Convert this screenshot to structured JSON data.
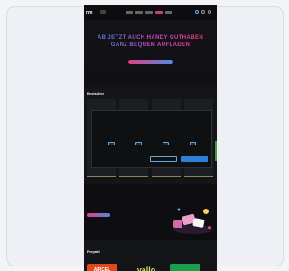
{
  "topbar": {
    "logo": "nm",
    "nav_links": [
      "",
      "",
      "",
      "",
      ""
    ]
  },
  "hero": {
    "title": "AB JETZT AUCH HANDY GUTHABEN GANZ BEQUEM AUFLADEN",
    "subtitle": "",
    "cta": ""
  },
  "section1": {
    "title": "Bestseller",
    "link": "",
    "cookie": {
      "heading": "",
      "logo": "",
      "text": "",
      "toggles": [
        "",
        "",
        "",
        ""
      ],
      "button_settings": "",
      "button_accept": ""
    }
  },
  "section2": {
    "title": "",
    "subtitle": "",
    "button": ""
  },
  "section3": {
    "title": "Prepaid",
    "link": "",
    "brands": [
      "AIRCEL",
      "yallo",
      ""
    ]
  },
  "colors": {
    "accent_pink": "#e04080",
    "accent_blue": "#4f8be0",
    "bg_dark": "#101114"
  }
}
